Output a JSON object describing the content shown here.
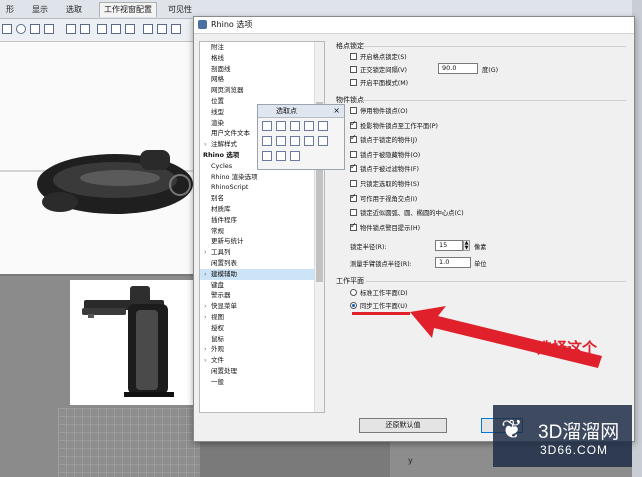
{
  "app": {
    "tabs": [
      "形",
      "显示",
      "选取",
      "工作视窗配置",
      "可见性"
    ],
    "axis_label": "y"
  },
  "dialog": {
    "title": "Rhino 选项",
    "tree": [
      {
        "label": "附注",
        "bold": false,
        "expand": false
      },
      {
        "label": "格线",
        "bold": false,
        "expand": false
      },
      {
        "label": "剖面线",
        "bold": false,
        "expand": false
      },
      {
        "label": "网格",
        "bold": false,
        "expand": false
      },
      {
        "label": "网页浏览器",
        "bold": false,
        "expand": false
      },
      {
        "label": "位置",
        "bold": false,
        "expand": false
      },
      {
        "label": "线型",
        "bold": false,
        "expand": false
      },
      {
        "label": "渲染",
        "bold": false,
        "expand": false
      },
      {
        "label": "用户文件文本",
        "bold": false,
        "expand": false
      },
      {
        "label": "注解样式",
        "bold": false,
        "expand": true
      },
      {
        "label": "Rhino 选项",
        "bold": true,
        "expand": false
      },
      {
        "label": "Cycles",
        "bold": false,
        "expand": false
      },
      {
        "label": "Rhino 渲染选项",
        "bold": false,
        "expand": false
      },
      {
        "label": "RhinoScript",
        "bold": false,
        "expand": false
      },
      {
        "label": "别名",
        "bold": false,
        "expand": false
      },
      {
        "label": "材质库",
        "bold": false,
        "expand": false
      },
      {
        "label": "插件程序",
        "bold": false,
        "expand": false
      },
      {
        "label": "常规",
        "bold": false,
        "expand": false
      },
      {
        "label": "更新与统计",
        "bold": false,
        "expand": false
      },
      {
        "label": "工具列",
        "bold": false,
        "expand": true
      },
      {
        "label": "闲置列表",
        "bold": false,
        "expand": false
      },
      {
        "label": "建模辅助",
        "bold": false,
        "expand": true,
        "selected": true
      },
      {
        "label": "键盘",
        "bold": false,
        "expand": false
      },
      {
        "label": "警示器",
        "bold": false,
        "expand": false
      },
      {
        "label": "快显菜单",
        "bold": false,
        "expand": true
      },
      {
        "label": "视图",
        "bold": false,
        "expand": true
      },
      {
        "label": "授权",
        "bold": false,
        "expand": false
      },
      {
        "label": "鼠标",
        "bold": false,
        "expand": false
      },
      {
        "label": "外观",
        "bold": false,
        "expand": true
      },
      {
        "label": "文件",
        "bold": false,
        "expand": true
      },
      {
        "label": "闲置处理",
        "bold": false,
        "expand": false
      },
      {
        "label": "一般",
        "bold": false,
        "expand": false
      }
    ],
    "grid_snap": {
      "title": "格点锁定",
      "items": [
        {
          "label": "开启格点锁定(S)",
          "checked": false
        },
        {
          "label": "正交锁定间隔(V)",
          "checked": false
        },
        {
          "label": "开启平面模式(M)",
          "checked": false
        }
      ],
      "ortho_value": "90.0",
      "ortho_unit": "度(G)"
    },
    "object_snap": {
      "title": "物件锁点",
      "items": [
        {
          "label": "停用物件锁点(O)",
          "checked": false
        },
        {
          "label": "投影物件锁点至工作平面(P)",
          "checked": true
        },
        {
          "label": "锁点于锁定的物件(J)",
          "checked": true
        },
        {
          "label": "锁点于被隐藏物件(O)",
          "checked": false
        },
        {
          "label": "锁点于被过滤物件(F)",
          "checked": true
        },
        {
          "label": "只锁定选取的物件(S)",
          "checked": false
        },
        {
          "label": "可作用于视角交点(I)",
          "checked": true
        },
        {
          "label": "锁定近似圆弧、圆、椭圆的中心点(C)",
          "checked": false
        },
        {
          "label": "物件锁点警目提示(H)",
          "checked": true
        }
      ],
      "radius_label": "锁定半径(R):",
      "radius_value": "15",
      "radius_unit": "像素",
      "tape_label": "测量手臂锁点半径(R):",
      "tape_value": "1.0",
      "tape_unit": "单位"
    },
    "cplane": {
      "title": "工作平面",
      "options": [
        {
          "label": "标准工作平面(D)",
          "selected": false
        },
        {
          "label": "同步工作平面(U)",
          "selected": true
        }
      ]
    },
    "restore_defaults": "还原默认值"
  },
  "snap_palette": {
    "title": "选取点",
    "close": "×"
  },
  "annotation": {
    "text": "选择这个",
    "color": "#e0202a"
  },
  "watermark": {
    "line1": "3D溜溜网",
    "line2": "3D66.COM"
  }
}
